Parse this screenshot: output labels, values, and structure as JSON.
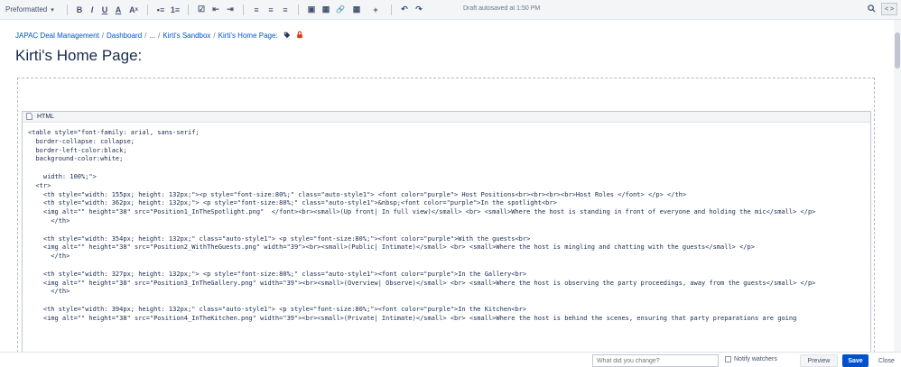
{
  "toolbar": {
    "style_select": "Preformatted",
    "buttons": [
      "B",
      "I",
      "U",
      "A",
      "Aˣ",
      "•≡",
      "1≡",
      "☑",
      "⇤",
      "⇥",
      "≡",
      "≡",
      "≡",
      "▣",
      "▦",
      "🔗",
      "▦",
      "+",
      "↶",
      "↷"
    ],
    "status": "Draft autosaved at 1:50 PM",
    "code_toggle": "< >"
  },
  "breadcrumb": {
    "items": [
      "JAPAC Deal Management",
      "Dashboard",
      "...",
      "Kirti's Sandbox",
      "Kirti's Home Page:"
    ]
  },
  "page": {
    "title": "Kirti's Home Page:"
  },
  "macro": {
    "label": "HTML",
    "code_lines": [
      "<table style=\"font-family: arial, sans-serif;",
      "  border-collapse: collapse;",
      "  border-left-color:black;",
      "  background-color:white;",
      "",
      "    width: 100%;\">",
      "  <tr>",
      "    <th style=\"width: 155px; height: 132px;\"><p style=\"font-size:80%;\" class=\"auto-style1\"> <font color=\"purple\"> Host Positions<br><br><br><br>Host Roles </font> </p> </th>",
      "    <th style=\"width: 362px; height: 132px;\"> <p style=\"font-size:80%;\" class=\"auto-style1\">&nbsp;<font color=\"purple\">In the spotlight<br>",
      "    <img alt=\"\" height=\"38\" src=\"Position1_InTheSpotlight.png\"  </font><br><small>(Up front| In full view)</small> <br> <small>Where the host is standing in front of everyone and holding the mic</small> </p>",
      "      </th>",
      "",
      "    <th style=\"width: 354px; height: 132px;\" class=\"auto-style1\"> <p style=\"font-size:80%;\"><font color=\"purple\">With the guests<br>",
      "    <img alt=\"\" height=\"38\" src=\"Position2_WithTheGuests.png\" width=\"39\"><br><small>(Public| Intimate)</small> <br> <small>Where the host is mingling and chatting with the guests</small> </p>",
      "      </th>",
      "",
      "    <th style=\"width: 327px; height: 132px;\"> <p style=\"font-size:80%;\" class=\"auto-style1\"><font color=\"purple\">In the Gallery<br>",
      "    <img alt=\"\" height=\"38\" src=\"Position3_InTheGallery.png\" width=\"39\"><br><small>(Overview| Observe)</small> <br> <small>Where the host is observing the party proceedings, away from the guests</small> </p>",
      "      </th>",
      "",
      "    <th style=\"width: 394px; height: 132px;\" class=\"auto-style1\"> <p style=\"font-size:80%;\"><font color=\"purple\">In the Kitchen<br>",
      "    <img alt=\"\" height=\"38\" src=\"Position4_InTheKitchen.png\" width=\"39\"><br><small>(Private| Intimate)</small> <br> <small>Where the host is behind the scenes, ensuring that party preparations are going"
    ]
  },
  "footer": {
    "change_placeholder": "What did you change?",
    "notify_label": "Notify watchers",
    "preview_label": "Preview",
    "save_label": "Save",
    "close_label": "Close"
  },
  "colors": {
    "link": "#0052cc",
    "primary_button": "#0052cc",
    "restriction_icon": "#de350b"
  }
}
